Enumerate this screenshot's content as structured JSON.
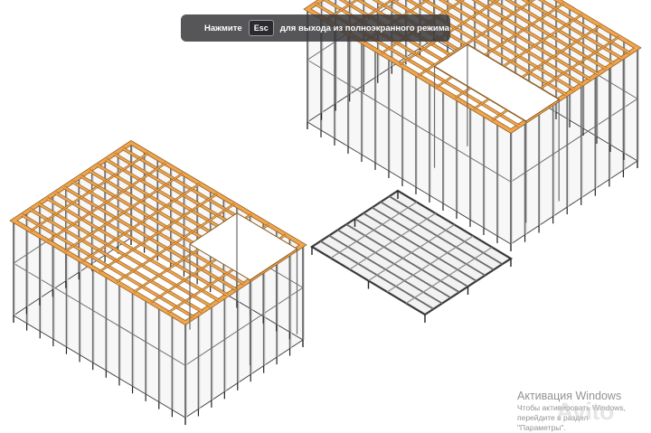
{
  "fullscreen_notice": {
    "before": "Нажмите",
    "key": "Esc",
    "after": "для выхода из полноэкранного режима"
  },
  "activation_watermark": {
    "title": "Активация Windows",
    "line1": "Чтобы активировать Windows, перейдите в раздел",
    "line2": "\"Параметры\"."
  },
  "brand_watermark": "Avito",
  "colors": {
    "joist_fill": "#f0a44c",
    "joist_stroke": "#8a5a1f",
    "stud": "#6c6c6c",
    "frame_edge": "#3a3a3a",
    "banner_bg": "#3a3a3e"
  }
}
